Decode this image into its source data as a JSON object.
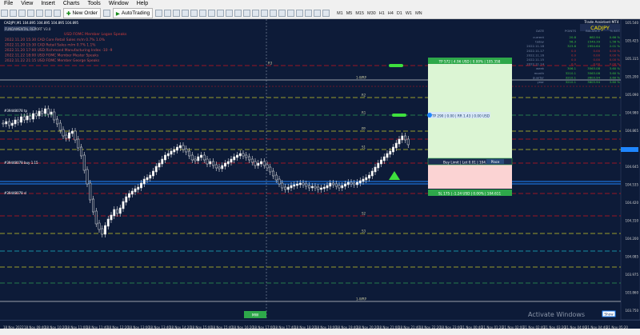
{
  "menu": [
    "File",
    "View",
    "Insert",
    "Charts",
    "Tools",
    "Window",
    "Help"
  ],
  "toolbar": {
    "new_order": "New Order",
    "autotrading": "AutoTrading",
    "timeframes": [
      "M1",
      "M5",
      "M15",
      "M30",
      "H1",
      "H4",
      "D1",
      "W1",
      "MN"
    ]
  },
  "chart": {
    "title": "CADJPY,M1  104.895 104.895 104.895 104.895",
    "indicator": "FUNDAMENTAL REPORT V3.0",
    "symbol_badge": "CADJPY",
    "assistant_title": "Trade Assistant MT4",
    "news": [
      "2022.11.20 15:30   CAD   Core Retail Sales m/m      0.7%   1.0%",
      "2022.11.20 15:30   CAD   Retail Sales m/m           0.7%   1.1%",
      "2022.11.20 17:00   USD   Richmond Manufacturing Index   -10   -9",
      "2022.11.22 18:00   USD   FOMC Member Mester Speaks",
      "2022.11.22 21:15   USD   FOMC Member George Speaks"
    ],
    "news_header": "USD FOMC Member Logan Speaks",
    "table_headers": [
      "DATE",
      "POINTS",
      "BALANCE",
      "% ACC"
    ],
    "table_rows": [
      [
        "current",
        "20.8",
        "662.94",
        "0.66 %"
      ],
      [
        "today",
        "56.3",
        "1549.39",
        "1.56 %"
      ],
      [
        "2022.11.18",
        "323.8",
        "2954.64",
        "2.01 %"
      ],
      [
        "2022.11.17",
        "0.0",
        "0.00",
        "0.00 %"
      ],
      [
        "2022.11.16",
        "0.0",
        "0.00",
        "0.00 %"
      ],
      [
        "2022.11.15",
        "0.0",
        "0.00",
        "0.00 %"
      ],
      [
        "2022.11.14",
        "0.0",
        "0.00",
        "0.00 %"
      ],
      [
        "week",
        "306.1",
        "3563.08",
        "3.60 %"
      ],
      [
        "month",
        "3210.1",
        "3563.08",
        "3.60 %"
      ],
      [
        "quarter",
        "3210.1",
        "3603.94",
        "3.60 %"
      ],
      [
        "year",
        "3210.1",
        "3603.94",
        "3.60 %"
      ]
    ],
    "tp_label": "TP 572 | 4.96 USD | 0.00% | 105.358",
    "rr_label": "TP 290 | 0.00 | RR 1.43 | 0.00 USD",
    "entry_label": "Buy Limit | Lot 0.01 | 104.736",
    "place_label": "Place",
    "sl_label": "SL 175 | -1.24 USD | 0.00% | 104.611",
    "left_labels": [
      "#39448078 tp",
      "#39448078 buy 1.15",
      "#39448078 sl"
    ],
    "level_labels": [
      "R3",
      "1-WRP",
      "R2",
      "R1",
      "PP",
      "S1",
      "S2",
      "S3",
      "1-WRP"
    ],
    "mw_label": "MW",
    "price_scale": [
      "105.540",
      "105.425",
      "105.315",
      "105.200",
      "105.090",
      "104.980",
      "104.865",
      "104.755",
      "104.645",
      "104.535",
      "104.420",
      "104.310",
      "104.200",
      "104.085",
      "103.975",
      "103.860",
      "103.750"
    ],
    "time_labels": [
      "18 Nov 2022",
      "18 Nov 09:40",
      "18 Nov 10:20",
      "18 Nov 11:00",
      "18 Nov 11:40",
      "18 Nov 12:20",
      "18 Nov 13:00",
      "18 Nov 13:40",
      "18 Nov 14:20",
      "18 Nov 15:00",
      "18 Nov 15:40",
      "18 Nov 16:20",
      "18 Nov 17:00",
      "18 Nov 17:40",
      "18 Nov 18:20",
      "18 Nov 19:00",
      "18 Nov 19:40",
      "18 Nov 20:20",
      "18 Nov 21:00",
      "18 Nov 21:40",
      "18 Nov 22:20",
      "18 Nov 23:00",
      "21 Nov 00:40",
      "21 Nov 01:20",
      "21 Nov 02:00",
      "21 Nov 02:40",
      "21 Nov 03:20",
      "21 Nov 04:00",
      "21 Nov 04:40",
      "21 Nov 05:20"
    ],
    "watermark": "Activate Windows",
    "watermark_sub": "Go to PC settings to activate Windows.",
    "show_button": "Show"
  }
}
